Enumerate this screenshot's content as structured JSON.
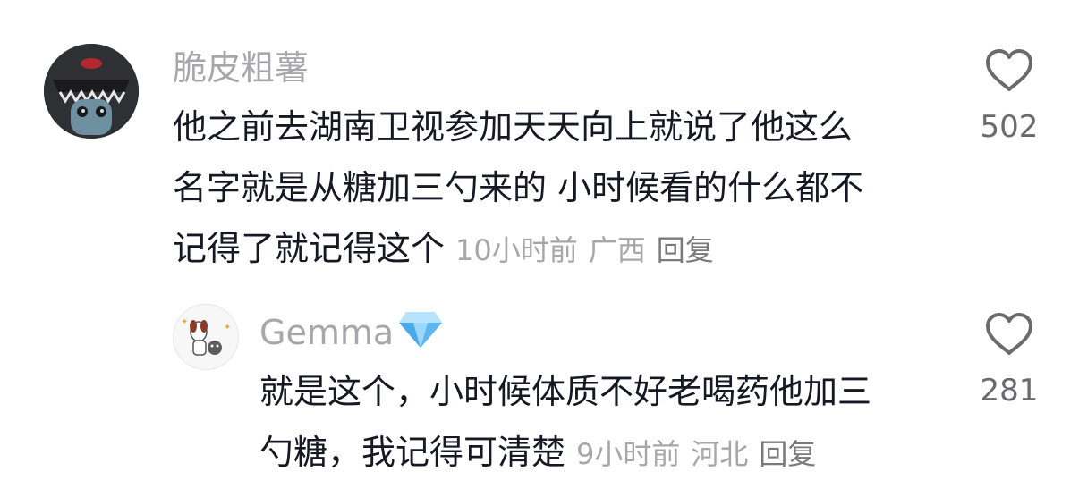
{
  "comments": [
    {
      "username": "脆皮粗薯",
      "text_lines": [
        "他之前去湖南卫视参加天天向上就说了他这么",
        "名字就是从糖加三勺来的 小时候看的什么都不",
        "记得了就记得这个"
      ],
      "time": "10小时前",
      "location": "广西",
      "reply_label": "回复",
      "like_count": "502"
    },
    {
      "username": "Gemma",
      "badge": "diamond-icon",
      "text_lines": [
        "就是这个，小时候体质不好老喝药他加三",
        "勺糖，我记得可清楚"
      ],
      "time": "9小时前",
      "location": "河北",
      "reply_label": "回复",
      "like_count": "281"
    }
  ]
}
